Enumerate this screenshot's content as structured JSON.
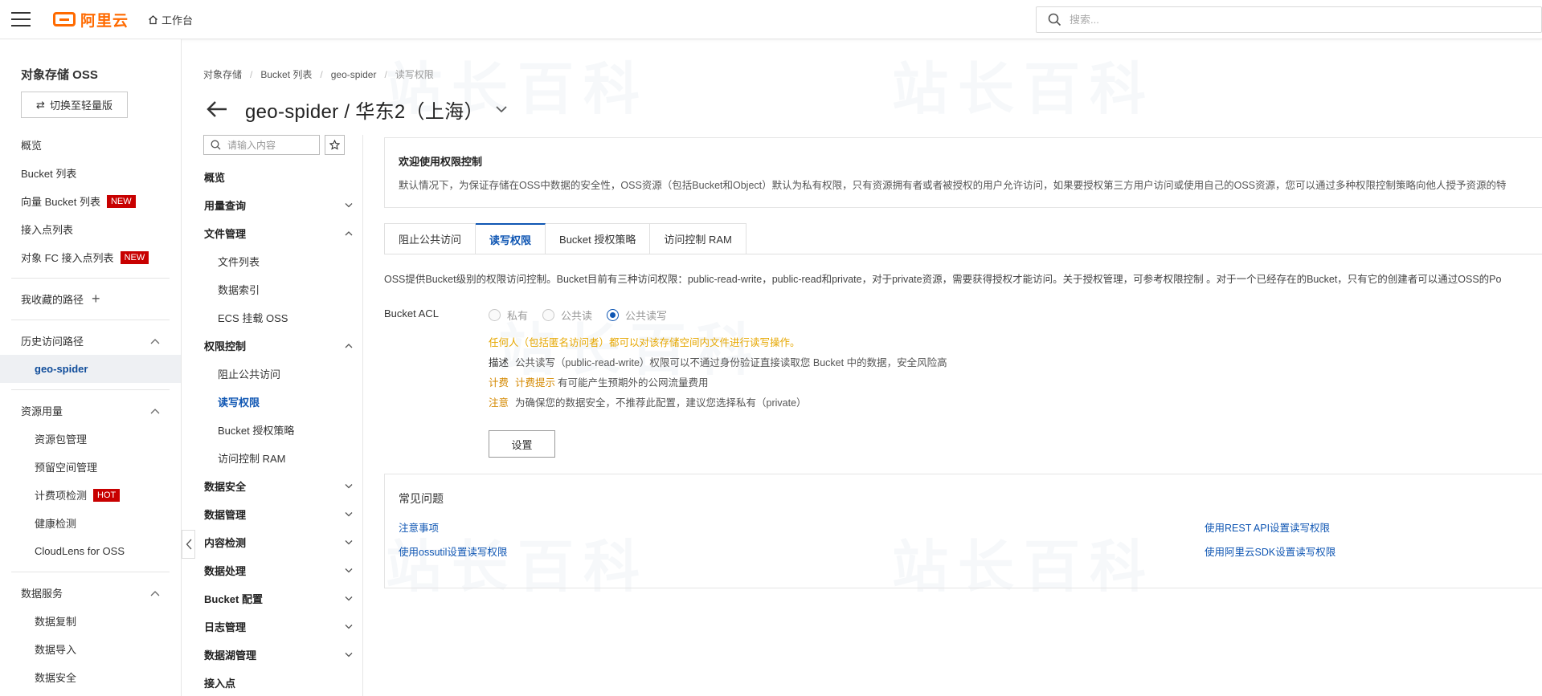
{
  "header": {
    "logo_text": "阿里云",
    "workbench_label": "工作台",
    "search_placeholder": "搜索..."
  },
  "sidebar": {
    "title": "对象存储 OSS",
    "switch_label": "切换至轻量版",
    "items": [
      {
        "label": "概览"
      },
      {
        "label": "Bucket 列表"
      },
      {
        "label": "向量 Bucket 列表",
        "badge": "NEW"
      },
      {
        "label": "接入点列表"
      },
      {
        "label": "对象 FC 接入点列表",
        "badge": "NEW"
      }
    ],
    "favorites_label": "我收藏的路径",
    "history_label": "历史访问路径",
    "history_items": [
      {
        "label": "geo-spider"
      }
    ],
    "resource_label": "资源用量",
    "resource_items": [
      {
        "label": "资源包管理"
      },
      {
        "label": "预留空间管理"
      },
      {
        "label": "计费项检测",
        "badge": "HOT"
      },
      {
        "label": "健康检测"
      },
      {
        "label": "CloudLens for OSS"
      }
    ],
    "data_service_label": "数据服务",
    "data_service_items": [
      {
        "label": "数据复制"
      },
      {
        "label": "数据导入"
      },
      {
        "label": "数据安全"
      }
    ]
  },
  "breadcrumb": [
    "对象存储",
    "Bucket 列表",
    "geo-spider",
    "读写权限"
  ],
  "page_title": "geo-spider / 华东2（上海）",
  "nav": {
    "search_placeholder": "请输入内容",
    "items": [
      {
        "label": "概览",
        "type": "group"
      },
      {
        "label": "用量查询",
        "type": "group",
        "chevron": "down"
      },
      {
        "label": "文件管理",
        "type": "group",
        "chevron": "up"
      },
      {
        "label": "文件列表",
        "type": "sub"
      },
      {
        "label": "数据索引",
        "type": "sub"
      },
      {
        "label": "ECS 挂载 OSS",
        "type": "sub"
      },
      {
        "label": "权限控制",
        "type": "group",
        "chevron": "up"
      },
      {
        "label": "阻止公共访问",
        "type": "sub"
      },
      {
        "label": "读写权限",
        "type": "sub",
        "active": true
      },
      {
        "label": "Bucket 授权策略",
        "type": "sub"
      },
      {
        "label": "访问控制 RAM",
        "type": "sub"
      },
      {
        "label": "数据安全",
        "type": "group",
        "chevron": "down"
      },
      {
        "label": "数据管理",
        "type": "group",
        "chevron": "down"
      },
      {
        "label": "内容检测",
        "type": "group",
        "chevron": "down"
      },
      {
        "label": "数据处理",
        "type": "group",
        "chevron": "down"
      },
      {
        "label": "Bucket 配置",
        "type": "group",
        "chevron": "down"
      },
      {
        "label": "日志管理",
        "type": "group",
        "chevron": "down"
      },
      {
        "label": "数据湖管理",
        "type": "group",
        "chevron": "down"
      },
      {
        "label": "接入点",
        "type": "group"
      }
    ]
  },
  "welcome": {
    "title": "欢迎使用权限控制",
    "desc": "默认情况下，为保证存储在OSS中数据的安全性，OSS资源（包括Bucket和Object）默认为私有权限，只有资源拥有者或者被授权的用户允许访问，如果要授权第三方用户访问或使用自己的OSS资源，您可以通过多种权限控制策略向他人授予资源的特"
  },
  "tabs": [
    {
      "label": "阻止公共访问"
    },
    {
      "label": "读写权限",
      "active": true
    },
    {
      "label": "Bucket 授权策略"
    },
    {
      "label": "访问控制 RAM"
    }
  ],
  "acl": {
    "intro": "OSS提供Bucket级别的权限访问控制。Bucket目前有三种访问权限：public-read-write，public-read和private，对于private资源，需要获得授权才能访问。关于授权管理，可参考权限控制 。对于一个已经存在的Bucket，只有它的创建者可以通过OSS的Po",
    "label": "Bucket ACL",
    "options": [
      {
        "label": "私有",
        "checked": false
      },
      {
        "label": "公共读",
        "checked": false
      },
      {
        "label": "公共读写",
        "checked": true
      }
    ],
    "warning": "任何人（包括匿名访问者）都可以对该存储空间内文件进行读写操作。",
    "desc_key": "描述",
    "desc_value": "公共读写（public-read-write）权限可以不通过身份验证直接读取您 Bucket 中的数据，安全风险高",
    "billing_key": "计费",
    "billing_hint": "计费提示",
    "billing_value": "有可能产生预期外的公网流量费用",
    "note_key": "注意",
    "note_value": "为确保您的数据安全，不推荐此配置，建议您选择私有（private）",
    "set_button": "设置"
  },
  "faq": {
    "title": "常见问题",
    "links": [
      "注意事项",
      "使用REST API设置读写权限",
      "使用ossutil设置读写权限",
      "使用阿里云SDK设置读写权限"
    ]
  },
  "watermark": "站长百科",
  "colors": {
    "brand": "#ff6a00",
    "link": "#0f56b3",
    "badge": "#c80000",
    "warning": "#e6a700"
  }
}
